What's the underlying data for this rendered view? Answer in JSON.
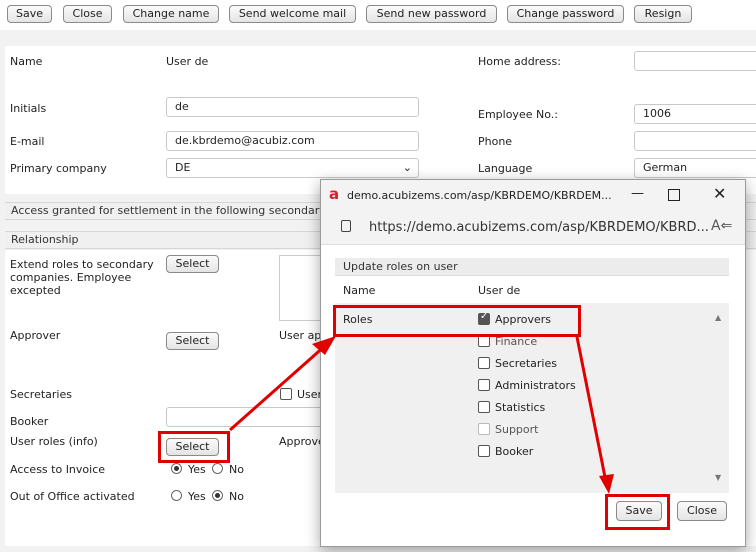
{
  "toolbar": {
    "save": "Save",
    "close": "Close",
    "change_name": "Change name",
    "send_welcome": "Send welcome mail",
    "send_password": "Send new password",
    "change_password": "Change password",
    "resign": "Resign"
  },
  "form": {
    "name_label": "Name",
    "name_value": "User de",
    "home_address_label": "Home address:",
    "initials_label": "Initials",
    "initials_value": "de",
    "employee_no_label": "Employee No.:",
    "employee_no_value": "1006",
    "email_label": "E-mail",
    "email_value": "de.kbrdemo@acubiz.com",
    "phone_label": "Phone",
    "primary_company_label": "Primary company",
    "primary_company_value": "DE",
    "language_label": "Language",
    "language_value": "German"
  },
  "sections": {
    "access_granted": "Access granted for settlement in the following secondary",
    "relationship": "Relationship"
  },
  "relationship": {
    "extend_roles_label": "Extend roles to secondary companies. Employee excepted",
    "select": "Select",
    "approver_label": "Approver",
    "user_ap_label": "User ap",
    "secretaries_label": "Secretaries",
    "user_label": "User",
    "booker_label": "Booker",
    "user_roles_label": "User roles (info)",
    "approve_label": "Approve",
    "access_invoice_label": "Access to Invoice",
    "out_of_office_label": "Out of Office activated",
    "yes": "Yes",
    "no": "No"
  },
  "popup": {
    "title": "demo.acubizems.com/asp/KBRDEMO/KBRDEM...",
    "url": "https://demo.acubizems.com/asp/KBRDEMO/KBRD...",
    "section_title": "Update roles on user",
    "col_name": "Name",
    "col_user": "User de",
    "roles_label": "Roles",
    "roles": [
      {
        "label": "Approvers",
        "checked": true
      },
      {
        "label": "Finance",
        "checked": false
      },
      {
        "label": "Secretaries",
        "checked": false
      },
      {
        "label": "Administrators",
        "checked": false
      },
      {
        "label": "Statistics",
        "checked": false
      },
      {
        "label": "Support",
        "checked": false
      },
      {
        "label": "Booker",
        "checked": false
      }
    ],
    "save": "Save",
    "close": "Close"
  },
  "colors": {
    "highlight": "#e00000",
    "brand": "#d61f26"
  }
}
